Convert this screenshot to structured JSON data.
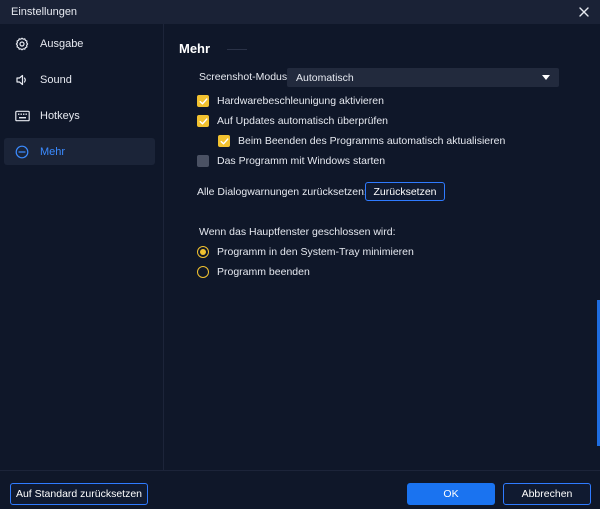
{
  "window": {
    "title": "Einstellungen"
  },
  "sidebar": {
    "items": [
      {
        "label": "Ausgabe",
        "icon": "gear-icon",
        "active": false
      },
      {
        "label": "Sound",
        "icon": "speaker-icon",
        "active": false
      },
      {
        "label": "Hotkeys",
        "icon": "keyboard-icon",
        "active": false
      },
      {
        "label": "Mehr",
        "icon": "more-icon",
        "active": true
      }
    ]
  },
  "main": {
    "section_title": "Mehr",
    "screenshot_mode": {
      "label": "Screenshot-Modus:",
      "value": "Automatisch"
    },
    "checkboxes": [
      {
        "label": "Hardwarebeschleunigung aktivieren",
        "checked": true
      },
      {
        "label": "Auf Updates automatisch überprüfen",
        "checked": true
      },
      {
        "label": "Beim Beenden des Programms automatisch aktualisieren",
        "checked": true
      },
      {
        "label": "Das Programm mit Windows starten",
        "checked": false
      }
    ],
    "reset_warnings": {
      "label": "Alle Dialogwarnungen zurücksetzen:",
      "button": "Zurücksetzen"
    },
    "close_behavior": {
      "label": "Wenn das Hauptfenster geschlossen wird:",
      "options": [
        {
          "label": "Programm in den System-Tray minimieren",
          "selected": true
        },
        {
          "label": "Programm beenden",
          "selected": false
        }
      ]
    }
  },
  "footer": {
    "default_label": "Auf Standard zurücksetzen",
    "ok_label": "OK",
    "cancel_label": "Abbrechen"
  },
  "colors": {
    "accent": "#2f7bff",
    "checkbox": "#f2c230",
    "background": "#0f1729"
  }
}
